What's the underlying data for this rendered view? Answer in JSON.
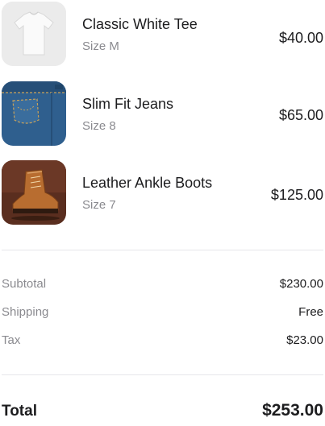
{
  "cart": {
    "items": [
      {
        "name": "Classic White Tee",
        "size": "Size M",
        "price": "$40.00",
        "image": "white-tshirt"
      },
      {
        "name": "Slim Fit Jeans",
        "size": "Size 8",
        "price": "$65.00",
        "image": "blue-jeans"
      },
      {
        "name": "Leather Ankle Boots",
        "size": "Size 7",
        "price": "$125.00",
        "image": "brown-leather-boot"
      }
    ]
  },
  "summary": {
    "subtotal_label": "Subtotal",
    "subtotal_value": "$230.00",
    "shipping_label": "Shipping",
    "shipping_value": "Free",
    "tax_label": "Tax",
    "tax_value": "$23.00"
  },
  "total": {
    "label": "Total",
    "value": "$253.00"
  }
}
